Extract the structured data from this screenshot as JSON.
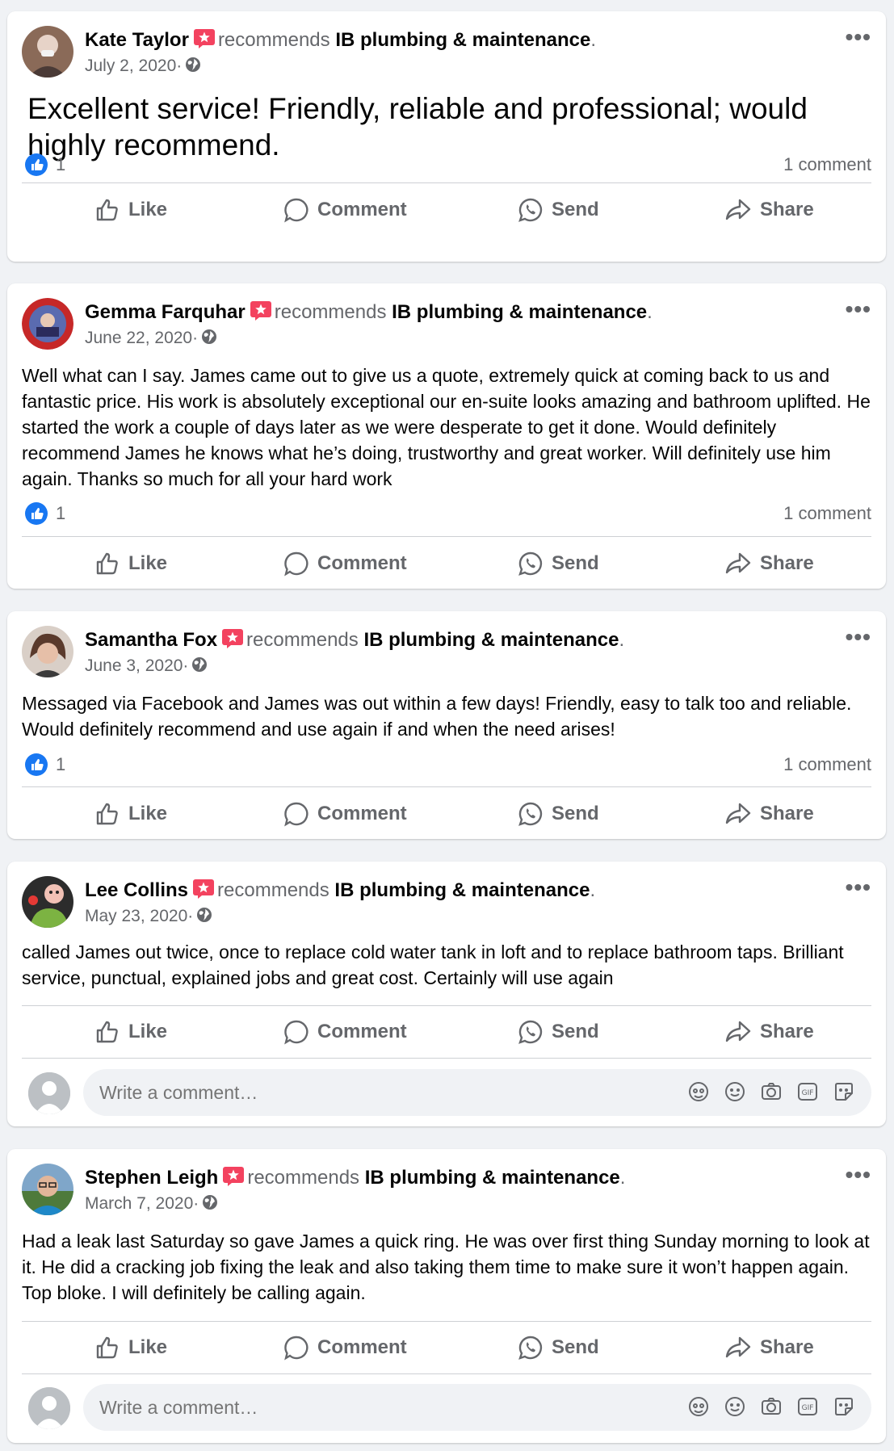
{
  "posts": [
    {
      "author": "Kate Taylor",
      "recommends": "recommends",
      "page": "IB plumbing & maintenance",
      "period": ".",
      "date": "July 2, 2020·",
      "text": "Excellent service! Friendly, reliable and professional; would highly recommend.",
      "reaction_count": "1",
      "comment_count": "1 comment"
    },
    {
      "author": "Gemma Farquhar",
      "recommends": "recommends",
      "page": "IB plumbing & maintenance",
      "period": ".",
      "date": "June 22, 2020·",
      "text": "Well what can I say. James came out to give us a quote, extremely quick at coming back to us and fantastic price. His work is absolutely exceptional our en-suite looks amazing and bathroom uplifted. He started the work a couple of days later as we were desperate to get it done. Would definitely recommend James he knows what he’s doing, trustworthy and great worker. Will definitely use him again. Thanks so much for all your hard work",
      "reaction_count": "1",
      "comment_count": "1 comment"
    },
    {
      "author": "Samantha Fox",
      "recommends": "recommends",
      "page": "IB plumbing & maintenance",
      "period": ".",
      "date": "June 3, 2020·",
      "text": "Messaged via Facebook and James was out within a few days! Friendly, easy to talk too and reliable. Would definitely recommend and use again if and when the need arises!",
      "reaction_count": "1",
      "comment_count": "1 comment"
    },
    {
      "author": "Lee Collins",
      "recommends": "recommends",
      "page": "IB plumbing & maintenance",
      "period": ".",
      "date": "May 23, 2020·",
      "text": "called James out twice, once to replace cold water tank in loft and to replace bathroom taps. Brilliant service, punctual, explained jobs and great cost. Certainly will use again"
    },
    {
      "author": "Stephen Leigh",
      "recommends": "recommends",
      "page": "IB plumbing & maintenance",
      "period": ".",
      "date": "March 7, 2020·",
      "text": "Had a leak last Saturday so gave James a quick ring. He was over first thing Sunday morning to look at it. He did a cracking job fixing the leak and also taking them time to make sure it won’t happen again. Top bloke. I will definitely be calling again."
    }
  ],
  "actions": {
    "like": "Like",
    "comment": "Comment",
    "send": "Send",
    "share": "Share"
  },
  "more_label": "•••",
  "comment_box": {
    "placeholder": "Write a comment…"
  },
  "icons": {
    "recommend_badge": "recommend-star-icon",
    "privacy": "globe-icon",
    "reaction": "like-reaction-icon",
    "like": "thumbs-up-icon",
    "comment": "speech-bubble-icon",
    "send": "messenger-icon",
    "share": "share-arrow-icon",
    "comment_box_icons": [
      "avatar-sticker-icon",
      "emoji-icon",
      "camera-icon",
      "gif-icon",
      "sticker-icon"
    ]
  },
  "colors": {
    "accent": "#1877f2",
    "badge": "#f3425f",
    "muted": "#65676b",
    "background": "#f0f2f5"
  }
}
